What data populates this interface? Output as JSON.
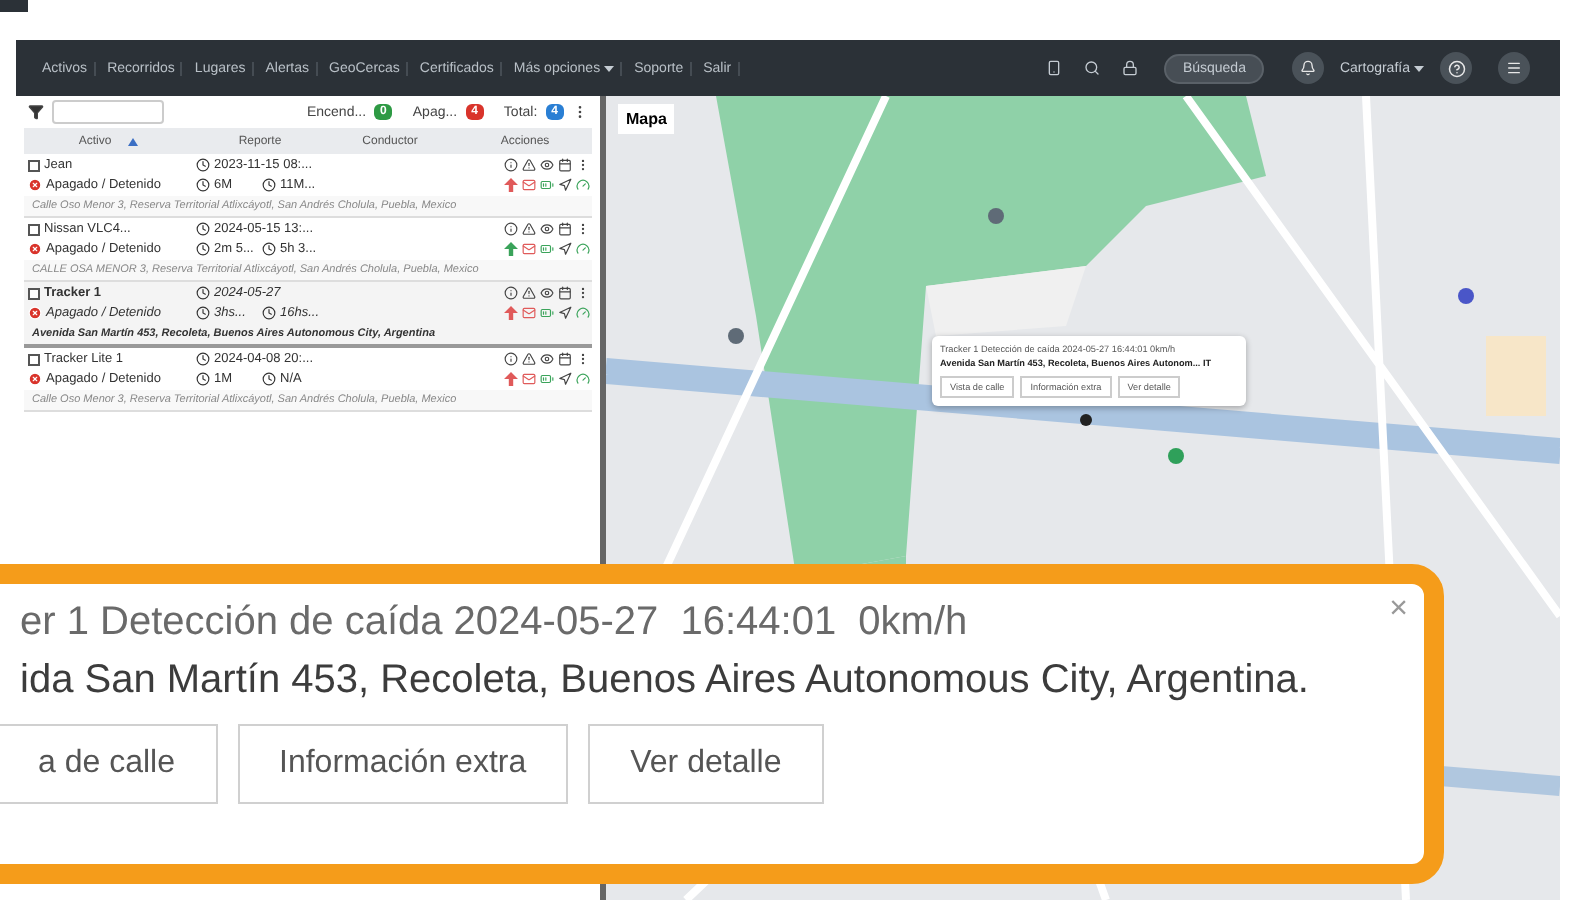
{
  "navbar": {
    "items": [
      {
        "label": "Activos"
      },
      {
        "label": "Recorridos"
      },
      {
        "label": "Lugares"
      },
      {
        "label": "Alertas"
      },
      {
        "label": "GeoCercas"
      },
      {
        "label": "Certificados"
      },
      {
        "label": "Más opciones",
        "dropdown": true
      },
      {
        "label": "Soporte"
      },
      {
        "label": "Salir"
      }
    ],
    "search_button": "Búsqueda",
    "map_menu": "Cartografía"
  },
  "panel": {
    "counters": [
      {
        "label": "Encend...",
        "count": "0",
        "color": "#2e9a44"
      },
      {
        "label": "Apag...",
        "count": "4",
        "color": "#d9342b"
      },
      {
        "label": "Total:",
        "count": "4",
        "color": "#2a7fd4"
      }
    ],
    "columns": [
      {
        "label": "Activo",
        "sorted": true
      },
      {
        "label": "Reporte",
        "sorted": false
      },
      {
        "label": "Conductor",
        "sorted": false
      },
      {
        "label": "Acciones",
        "sorted": false
      }
    ],
    "rows": [
      {
        "name": "Jean",
        "status": "Apagado / Detenido",
        "date": "2023-11-15 08:...",
        "duration_1": "6M",
        "duration_2": "11M...",
        "address": "Calle Oso Menor 3, Reserva Territorial Atlixcáyotl, San Andrés Cholula, Puebla, Mexico",
        "selected": false,
        "checked": false,
        "color": "#e05a5a"
      },
      {
        "name": "Nissan VLC4...",
        "status": "Apagado / Detenido",
        "date": "2024-05-15 13:...",
        "duration_1": "2m 5...",
        "duration_2": "5h 3...",
        "address": "CALLE OSA MENOR 3, Reserva Territorial Atlixcáyotl, San Andrés Cholula, Puebla, Mexico",
        "selected": false,
        "checked": false,
        "color": "#3aa35a"
      },
      {
        "name": "Tracker 1",
        "status": "Apagado / Detenido",
        "date": "2024-05-27",
        "duration_1": "3hs...",
        "duration_2": "16hs...",
        "address": "Avenida San Martín 453, Recoleta, Buenos Aires Autonomous City, Argentina",
        "selected": true,
        "checked": false,
        "color": "#e05a5a"
      },
      {
        "name": "Tracker Lite 1",
        "status": "Apagado / Detenido",
        "date": "2024-04-08 20:...",
        "duration_1": "1M",
        "duration_2": "N/A",
        "address": "Calle Oso Menor 3, Reserva Territorial Atlixcáyotl, San Andrés Cholula, Puebla, Mexico",
        "selected": false,
        "checked": false,
        "color": "#e05a5a"
      }
    ]
  },
  "map": {
    "type_button": "Mapa",
    "popup": {
      "title": "Tracker 1 Detección de caída 2024-05-27 16:44:01 0km/h",
      "address": "Avenida San Martín 453, Recoleta, Buenos Aires Autonom... IT",
      "buttons": [
        "Vista de calle",
        "Información extra",
        "Ver detalle"
      ]
    }
  },
  "callout": {
    "close": "×",
    "title": "er 1 Detección de caída 2024-05-27  16:44:01  0km/h",
    "address": "ida San Martín 453, Recoleta, Buenos Aires Autonomous City, Argentina.",
    "buttons": [
      "a de calle",
      "Información extra",
      "Ver detalle"
    ]
  }
}
